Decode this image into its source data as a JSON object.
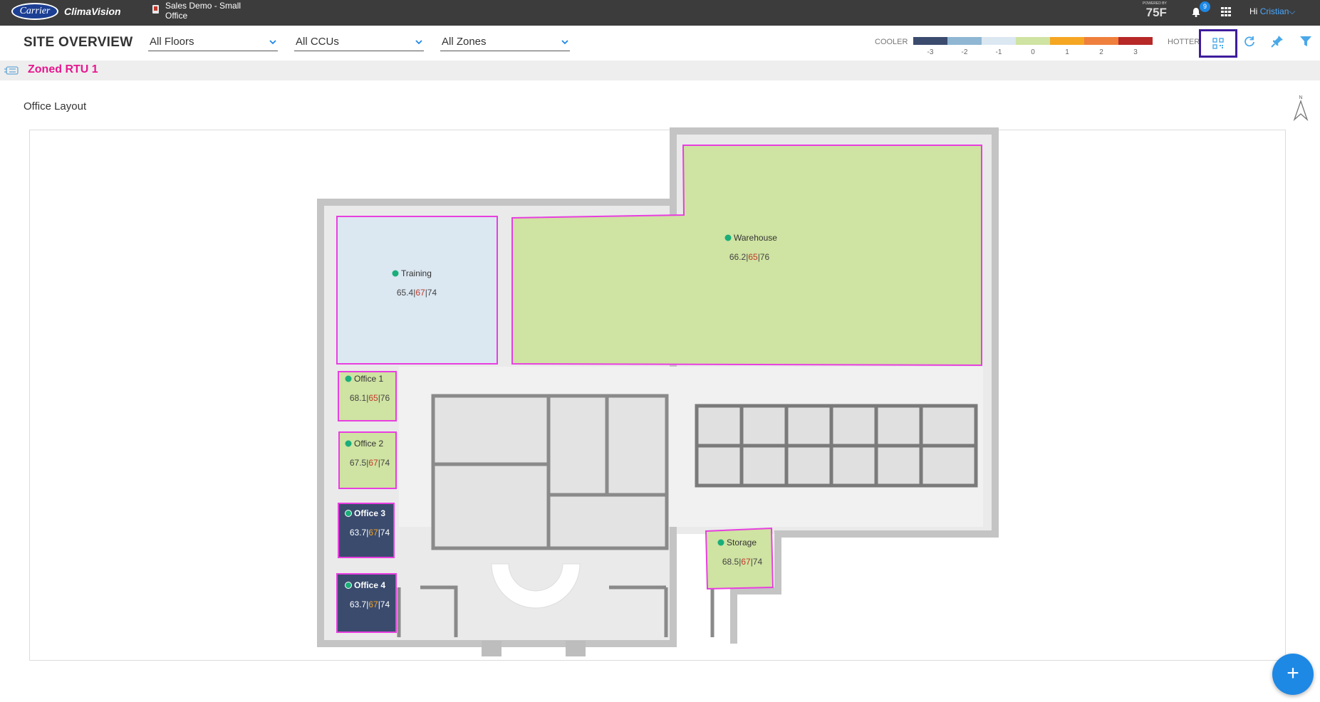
{
  "topbar": {
    "logo_text": "Carrier",
    "app_name": "ClimaVision",
    "site_name": "Sales Demo - Small Office",
    "brand_small": "POWERED BY",
    "brand": "75F",
    "notification_count": "9",
    "greeting": "Hi",
    "user_name": "Cristian"
  },
  "header": {
    "title": "SITE OVERVIEW",
    "filters": {
      "floors": "All Floors",
      "ccus": "All CCUs",
      "zones": "All Zones"
    },
    "legend": {
      "cooler_label": "COOLER",
      "hotter_label": "HOTTER",
      "ticks": [
        "-3",
        "-2",
        "-1",
        "0",
        "1",
        "2",
        "3"
      ],
      "colors": [
        "#3a4b6e",
        "#8fb6d2",
        "#dbe7f1",
        "#cfe3a2",
        "#f5a623",
        "#ef7f3c",
        "#b72828"
      ]
    }
  },
  "breadcrumb": {
    "label": "Zoned RTU 1"
  },
  "layout": {
    "section_title": "Office Layout",
    "compass_label": "N",
    "zones": [
      {
        "name": "Training",
        "current": "65.4",
        "set": "67",
        "max": "74",
        "fill": "#dbe7f1",
        "set_color": "#c0392b"
      },
      {
        "name": "Warehouse",
        "current": "66.2",
        "set": "65",
        "max": "76",
        "fill": "#cfe3a2",
        "set_color": "#c0392b"
      },
      {
        "name": "Office 1",
        "current": "68.1",
        "set": "65",
        "max": "76",
        "fill": "#cfe3a2",
        "set_color": "#c0392b"
      },
      {
        "name": "Office 2",
        "current": "67.5",
        "set": "67",
        "max": "74",
        "fill": "#cfe3a2",
        "set_color": "#c0392b"
      },
      {
        "name": "Office 3",
        "current": "63.7",
        "set": "67",
        "max": "74",
        "fill": "#3a4b6e",
        "set_color": "#f5a623"
      },
      {
        "name": "Office 4",
        "current": "63.7",
        "set": "67",
        "max": "74",
        "fill": "#3a4b6e",
        "set_color": "#f5a623"
      },
      {
        "name": "Storage",
        "current": "68.5",
        "set": "67",
        "max": "74",
        "fill": "#cfe3a2",
        "set_color": "#c0392b"
      }
    ]
  },
  "fab_label": "+"
}
